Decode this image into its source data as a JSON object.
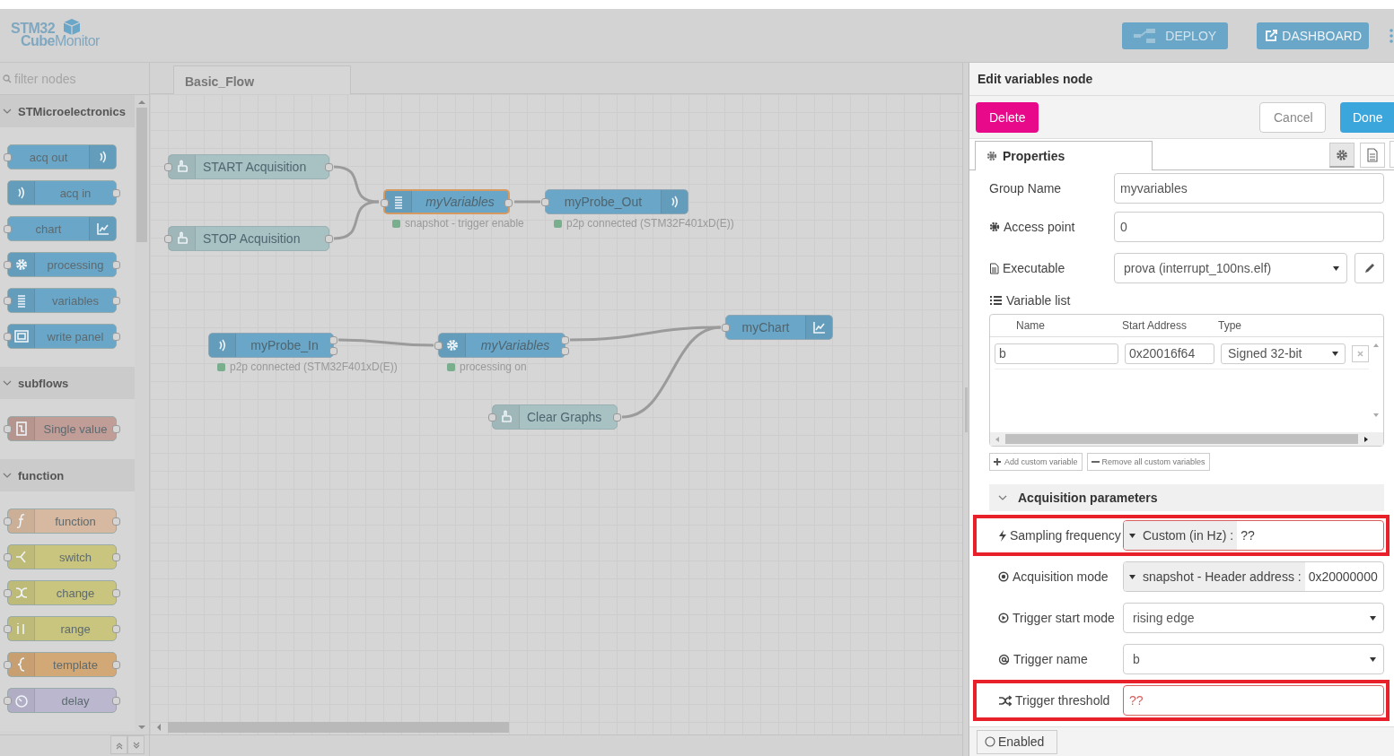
{
  "header": {
    "logo": {
      "line1": "STM32",
      "line2a": "Cube",
      "line2b": "Monitor"
    },
    "buttons": [
      {
        "label": "DEPLOY",
        "kind": "deploy",
        "disabled": true
      },
      {
        "label": "DASHBOARD",
        "kind": "dashboard",
        "disabled": false
      }
    ]
  },
  "palette": {
    "filter": {
      "placeholder": "filter nodes"
    },
    "categories": [
      {
        "name": "STMicroelectronics",
        "expanded": true,
        "nodes": [
          {
            "label": "acq out",
            "kind": "acq-out",
            "color": "#6aa6c7"
          },
          {
            "label": "acq in",
            "kind": "acq-in",
            "color": "#6aa6c7"
          },
          {
            "label": "chart",
            "kind": "chart",
            "color": "#6aa6c7"
          },
          {
            "label": "processing",
            "kind": "processing",
            "color": "#6aa6c7"
          },
          {
            "label": "variables",
            "kind": "variables",
            "color": "#6aa6c7"
          },
          {
            "label": "write panel",
            "kind": "write-panel",
            "color": "#6aa6c7"
          }
        ]
      },
      {
        "name": "subflows",
        "expanded": true,
        "nodes": [
          {
            "label": "Single value",
            "kind": "subflow",
            "color": "#c09d96"
          }
        ]
      },
      {
        "name": "function",
        "expanded": true,
        "nodes": [
          {
            "label": "function",
            "kind": "function",
            "color": "#d6b9a0"
          },
          {
            "label": "switch",
            "kind": "switch",
            "color": "#c9c57f"
          },
          {
            "label": "change",
            "kind": "change",
            "color": "#c9c57f"
          },
          {
            "label": "range",
            "kind": "range",
            "color": "#c9c57f"
          },
          {
            "label": "template",
            "kind": "template",
            "color": "#d2a876"
          },
          {
            "label": "delay",
            "kind": "delay",
            "color": "#bab7cf"
          }
        ]
      }
    ]
  },
  "workspace": {
    "tabs": [
      {
        "label": "Basic_Flow",
        "selected": true
      }
    ],
    "nodes": [
      {
        "label": "START Acquisition",
        "kind": "inject",
        "italic": false,
        "selected": false
      },
      {
        "label": "STOP Acquisition",
        "kind": "inject",
        "italic": false,
        "selected": false
      },
      {
        "label": "myVariables",
        "kind": "variables",
        "italic": true,
        "selected": true,
        "status": {
          "text": "snapshot - trigger enable",
          "color": "#7aaf8e"
        }
      },
      {
        "label": "myProbe_Out",
        "kind": "acq-out",
        "italic": false,
        "selected": false,
        "status": {
          "text": "p2p connected (STM32F401xD(E))",
          "color": "#7aaf8e"
        }
      },
      {
        "label": "myProbe_In",
        "kind": "acq-in",
        "italic": false,
        "selected": false,
        "status": {
          "text": "p2p connected (STM32F401xD(E))",
          "color": "#7aaf8e"
        }
      },
      {
        "label": "myVariables",
        "kind": "processing",
        "italic": true,
        "selected": false,
        "status": {
          "text": "processing on",
          "color": "#7aaf8e"
        }
      },
      {
        "label": "myChart",
        "kind": "chart",
        "italic": false,
        "selected": false
      },
      {
        "label": "Clear Graphs",
        "kind": "inject",
        "italic": false,
        "selected": false
      }
    ]
  },
  "editor": {
    "title": "Edit variables node",
    "buttons": [
      {
        "label": "Delete",
        "kind": "danger"
      },
      {
        "label": "Cancel",
        "kind": "plain"
      },
      {
        "label": "Done",
        "kind": "primary"
      }
    ],
    "tabs": [
      {
        "label": "Properties",
        "selected": true
      }
    ],
    "side_tabs": [
      {
        "kind": "settings",
        "selected": true
      },
      {
        "kind": "description",
        "selected": false
      }
    ],
    "rows": [
      {
        "label": "Group Name",
        "kind": "text",
        "value": "myvariables"
      },
      {
        "label": "Access point",
        "kind": "text",
        "value": "0"
      },
      {
        "label": "Executable",
        "kind": "select_edit",
        "value": "prova (interrupt_100ns.elf)"
      }
    ],
    "variable_list": {
      "label": "Variable list",
      "columns": [
        "Name",
        "Start Address",
        "Type"
      ],
      "rows": [
        {
          "name": "b",
          "address": "0x20016f64",
          "type": "Signed 32-bit"
        }
      ],
      "buttons": [
        {
          "label": "Add custom variable",
          "kind": "add"
        },
        {
          "label": "Remove all custom variables",
          "kind": "remove"
        }
      ]
    },
    "section": {
      "title": "Acquisition parameters",
      "expanded": true,
      "rows": [
        {
          "label": "Sampling frequency",
          "kind": "typed",
          "type_label": "Custom (in Hz) :",
          "value": "??",
          "highlighted": true,
          "invalid": true
        },
        {
          "label": "Acquisition mode",
          "kind": "typed",
          "type_label": "snapshot - Header address :",
          "value": "0x20000000",
          "highlighted": false,
          "invalid": false
        },
        {
          "label": "Trigger start mode",
          "kind": "select",
          "value": "rising edge",
          "highlighted": false,
          "invalid": false
        },
        {
          "label": "Trigger name",
          "kind": "select",
          "value": "b",
          "highlighted": false,
          "invalid": false
        },
        {
          "label": "Trigger threshold",
          "kind": "text",
          "value": "??",
          "highlighted": true,
          "invalid": true
        }
      ]
    },
    "footer": {
      "label": "Enabled"
    }
  }
}
